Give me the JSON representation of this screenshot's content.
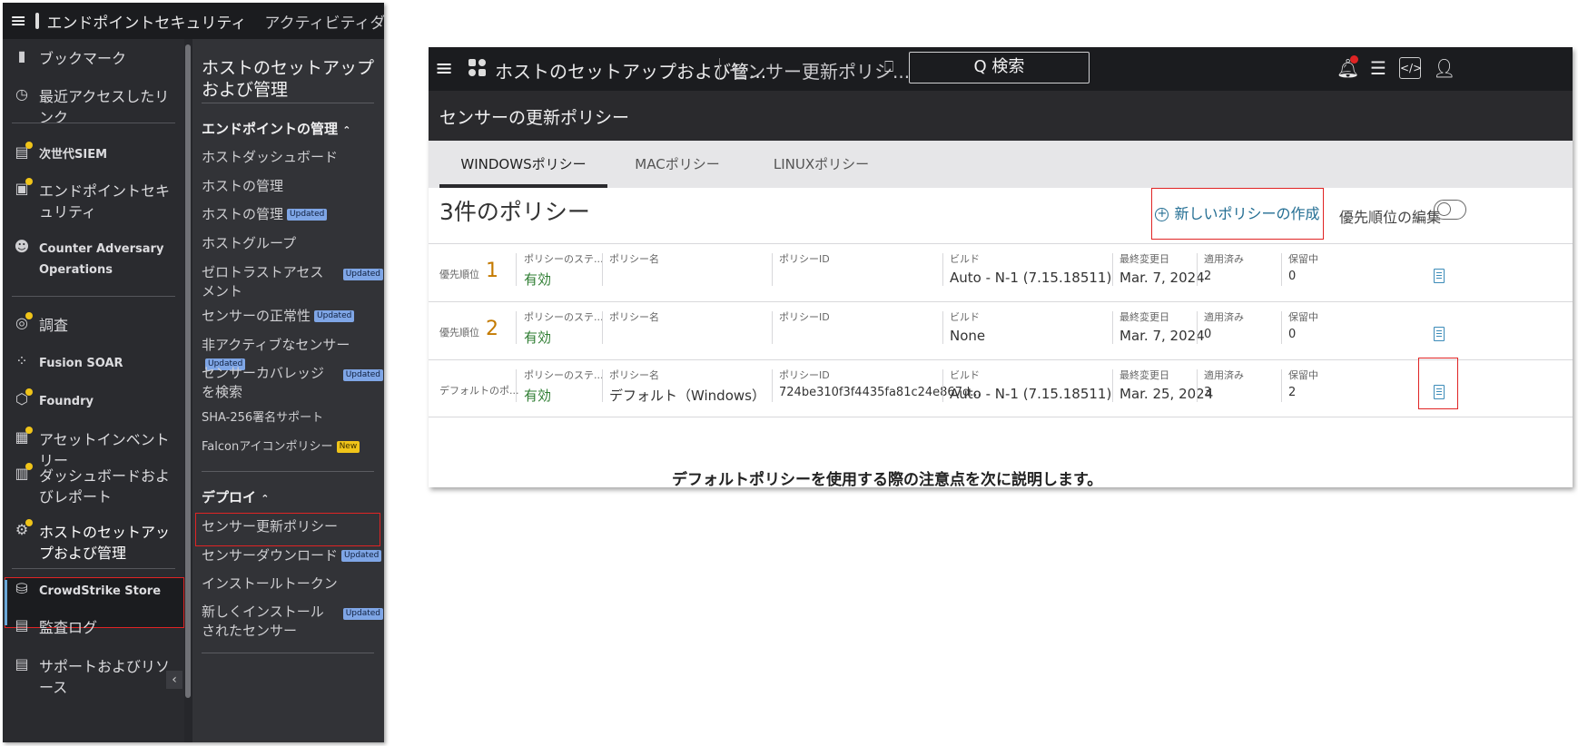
{
  "left_header": {
    "app_name": "エンドポイントセキュリティ",
    "breadcrumb": "アクティビティダッシュボー"
  },
  "nav_primary": {
    "items": [
      {
        "label": "ブックマーク",
        "icon": "bookmark-icon"
      },
      {
        "label": "最近アクセスしたリンク",
        "icon": "recent-icon"
      },
      {
        "label": "次世代SIEM",
        "icon": "siem-icon"
      },
      {
        "label": "エンドポイントセキュリティ",
        "icon": "endpoint-icon"
      },
      {
        "label": "Counter Adversary Operations",
        "icon": "counter-adversary-icon"
      },
      {
        "label": "調査",
        "icon": "investigate-icon"
      },
      {
        "label": "Fusion SOAR",
        "icon": "fusion-icon"
      },
      {
        "label": "Foundry",
        "icon": "foundry-icon"
      },
      {
        "label": "アセットインベントリー",
        "icon": "asset-icon"
      },
      {
        "label": "ダッシュボードおよびレポート",
        "icon": "dashboard-icon"
      },
      {
        "label": "ホストのセットアップおよび管理",
        "icon": "host-setup-icon"
      },
      {
        "label": "CrowdStrike Store",
        "icon": "store-icon"
      },
      {
        "label": "監査ログ",
        "icon": "audit-log-icon"
      },
      {
        "label": "サポートおよびリソース",
        "icon": "support-icon"
      }
    ],
    "collapse": "‹"
  },
  "nav_secondary": {
    "title": "ホストのセットアップおよび管理",
    "section1": "エンドポイントの管理",
    "section1_items": [
      {
        "label": "ホストダッシュボード",
        "badge": ""
      },
      {
        "label": "ホストの管理",
        "badge": ""
      },
      {
        "label": "ホストの管理",
        "badge": "Updated"
      },
      {
        "label": "ホストグループ",
        "badge": ""
      },
      {
        "label": "ゼロトラストアセスメント",
        "badge": "Updated"
      },
      {
        "label": "センサーの正常性",
        "badge": "Updated"
      },
      {
        "label": "非アクティブなセンサー",
        "badge": "Updated"
      },
      {
        "label": "センサーカバレッジを検索",
        "badge": "Updated"
      },
      {
        "label": "SHA-256署名サポート",
        "badge": ""
      },
      {
        "label": "Falconアイコンポリシー",
        "badge": "New"
      }
    ],
    "section2": "デプロイ",
    "section2_items": [
      {
        "label": "センサー更新ポリシー",
        "badge": ""
      },
      {
        "label": "センサーダウンロード",
        "badge": "Updated"
      },
      {
        "label": "インストールトークン",
        "badge": ""
      },
      {
        "label": "新しくインストールされたセンサー",
        "badge": "Updated"
      }
    ]
  },
  "topbar": {
    "title": "ホストのセットアップおよび管...",
    "breadcrumb": "センサー更新ポリシ...",
    "search": "Q 検索"
  },
  "page": {
    "heading": "センサーの更新ポリシー",
    "tabs": [
      "WINDOWSポリシー",
      "MACポリシー",
      "LINUXポリシー"
    ],
    "count": "3件のポリシー",
    "new_policy": "新しいポリシーの作成",
    "priority_edit": "優先順位の編集"
  },
  "table": {
    "headers": {
      "status": "ポリシーのステ...",
      "name": "ポリシー名",
      "id": "ポリシーID",
      "build": "ビルド",
      "modified": "最終変更日",
      "applied": "適用済み",
      "pending": "保留中"
    },
    "rows": [
      {
        "prio_label": "優先順位",
        "prio_num": "1",
        "status": "有効",
        "name": "",
        "id": "",
        "build": "Auto - N-1 (7.15.18511)",
        "modified": "Mar. 7, 2024",
        "applied": "2",
        "pending": "0"
      },
      {
        "prio_label": "優先順位",
        "prio_num": "2",
        "status": "有効",
        "name": "",
        "id": "",
        "build": "None",
        "modified": "Mar. 7, 2024",
        "applied": "0",
        "pending": "0"
      },
      {
        "prio_label": "デフォルトのポ...",
        "prio_num": "",
        "status": "有効",
        "name": "デフォルト（Windows）",
        "id": "724be310f3f4435fa81c24e867d...",
        "build": "Auto - N-1 (7.15.18511)",
        "modified": "Mar. 25, 2024",
        "applied": "3",
        "pending": "2"
      }
    ]
  },
  "caption": "デフォルトポリシーを使用する際の注意点を次に説明します。",
  "colors": {
    "highlight": "#e02424",
    "link": "#236e93",
    "active_status": "#2e7d32",
    "priority": "#c47a00"
  }
}
